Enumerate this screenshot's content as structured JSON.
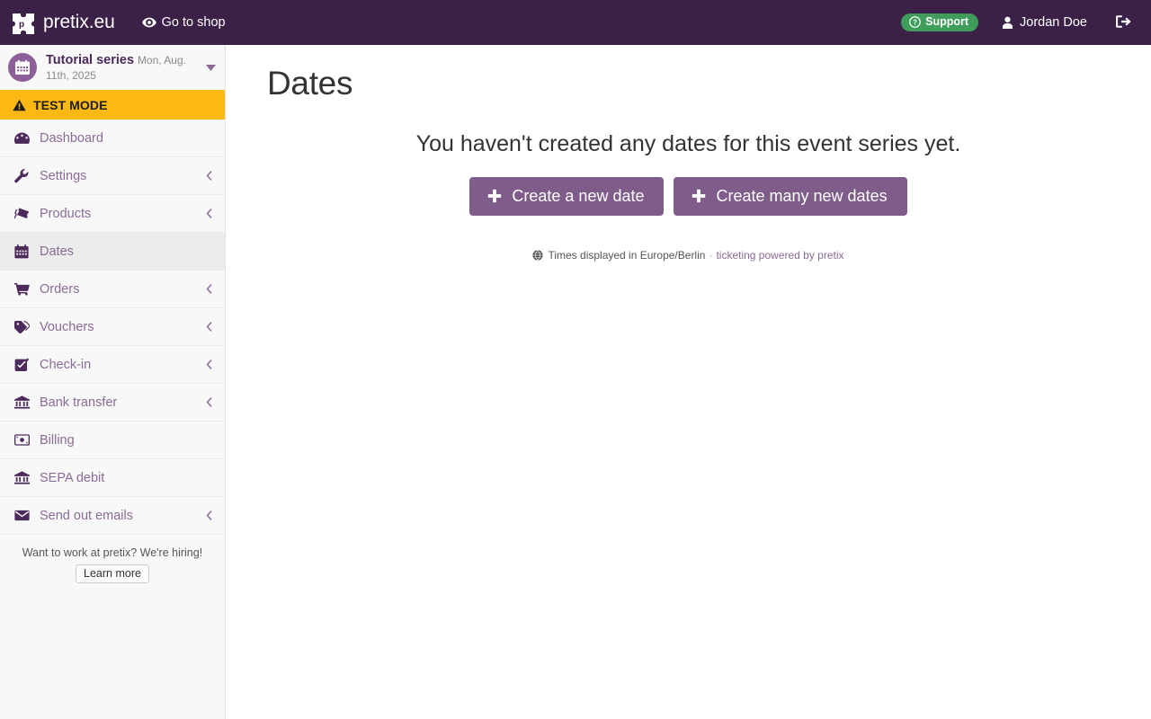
{
  "navbar": {
    "brand": "pretix.eu",
    "brand_logo_icon": "pretix-ticket-logo-icon",
    "shop_link": {
      "label": "Go to shop",
      "icon": "eye-icon"
    },
    "support": {
      "label": "Support",
      "icon": "question-circle-icon",
      "color": "#3f9c5a"
    },
    "user": {
      "label": "Jordan Doe",
      "icon": "user-icon"
    },
    "logout": {
      "icon": "sign-out-icon"
    },
    "background_color": "#3b2048"
  },
  "sidebar": {
    "event": {
      "name": "Tutorial series",
      "date": "Mon, Aug. 11th, 2025",
      "avatar_icon": "calendar-icon",
      "caret_icon": "caret-down-icon"
    },
    "test_mode": {
      "label": "TEST MODE",
      "icon": "warning-triangle-icon",
      "color": "#fcb813"
    },
    "items": [
      {
        "label": "Dashboard",
        "icon": "dashboard-icon",
        "has_chevron": false,
        "active": false
      },
      {
        "label": "Settings",
        "icon": "wrench-icon",
        "has_chevron": true,
        "active": false
      },
      {
        "label": "Products",
        "icon": "tickets-icon",
        "has_chevron": true,
        "active": false
      },
      {
        "label": "Dates",
        "icon": "calendar-icon",
        "has_chevron": false,
        "active": true
      },
      {
        "label": "Orders",
        "icon": "shopping-cart-icon",
        "has_chevron": true,
        "active": false
      },
      {
        "label": "Vouchers",
        "icon": "tag-icon",
        "has_chevron": true,
        "active": false
      },
      {
        "label": "Check-in",
        "icon": "check-square-icon",
        "has_chevron": true,
        "active": false
      },
      {
        "label": "Bank transfer",
        "icon": "bank-icon",
        "has_chevron": true,
        "active": false
      },
      {
        "label": "Billing",
        "icon": "money-bill-icon",
        "has_chevron": false,
        "active": false
      },
      {
        "label": "SEPA debit",
        "icon": "bank-icon",
        "has_chevron": false,
        "active": false
      },
      {
        "label": "Send out emails",
        "icon": "envelope-icon",
        "has_chevron": true,
        "active": false
      }
    ],
    "chevron_icon": "chevron-left-icon",
    "hiring": {
      "text": "Want to work at pretix? We're hiring!",
      "button_label": "Learn more"
    }
  },
  "main": {
    "title": "Dates",
    "empty_heading": "You haven't created any dates for this event series yet.",
    "buttons": [
      {
        "label": "Create a new date",
        "icon": "plus-icon"
      },
      {
        "label": "Create many new dates",
        "icon": "plus-icon"
      }
    ],
    "footer": {
      "icon": "globe-icon",
      "timezone_text": "Times displayed in Europe/Berlin",
      "separator": "·",
      "link_label": "ticketing powered by pretix"
    },
    "accent_color": "#7f5c8a"
  }
}
